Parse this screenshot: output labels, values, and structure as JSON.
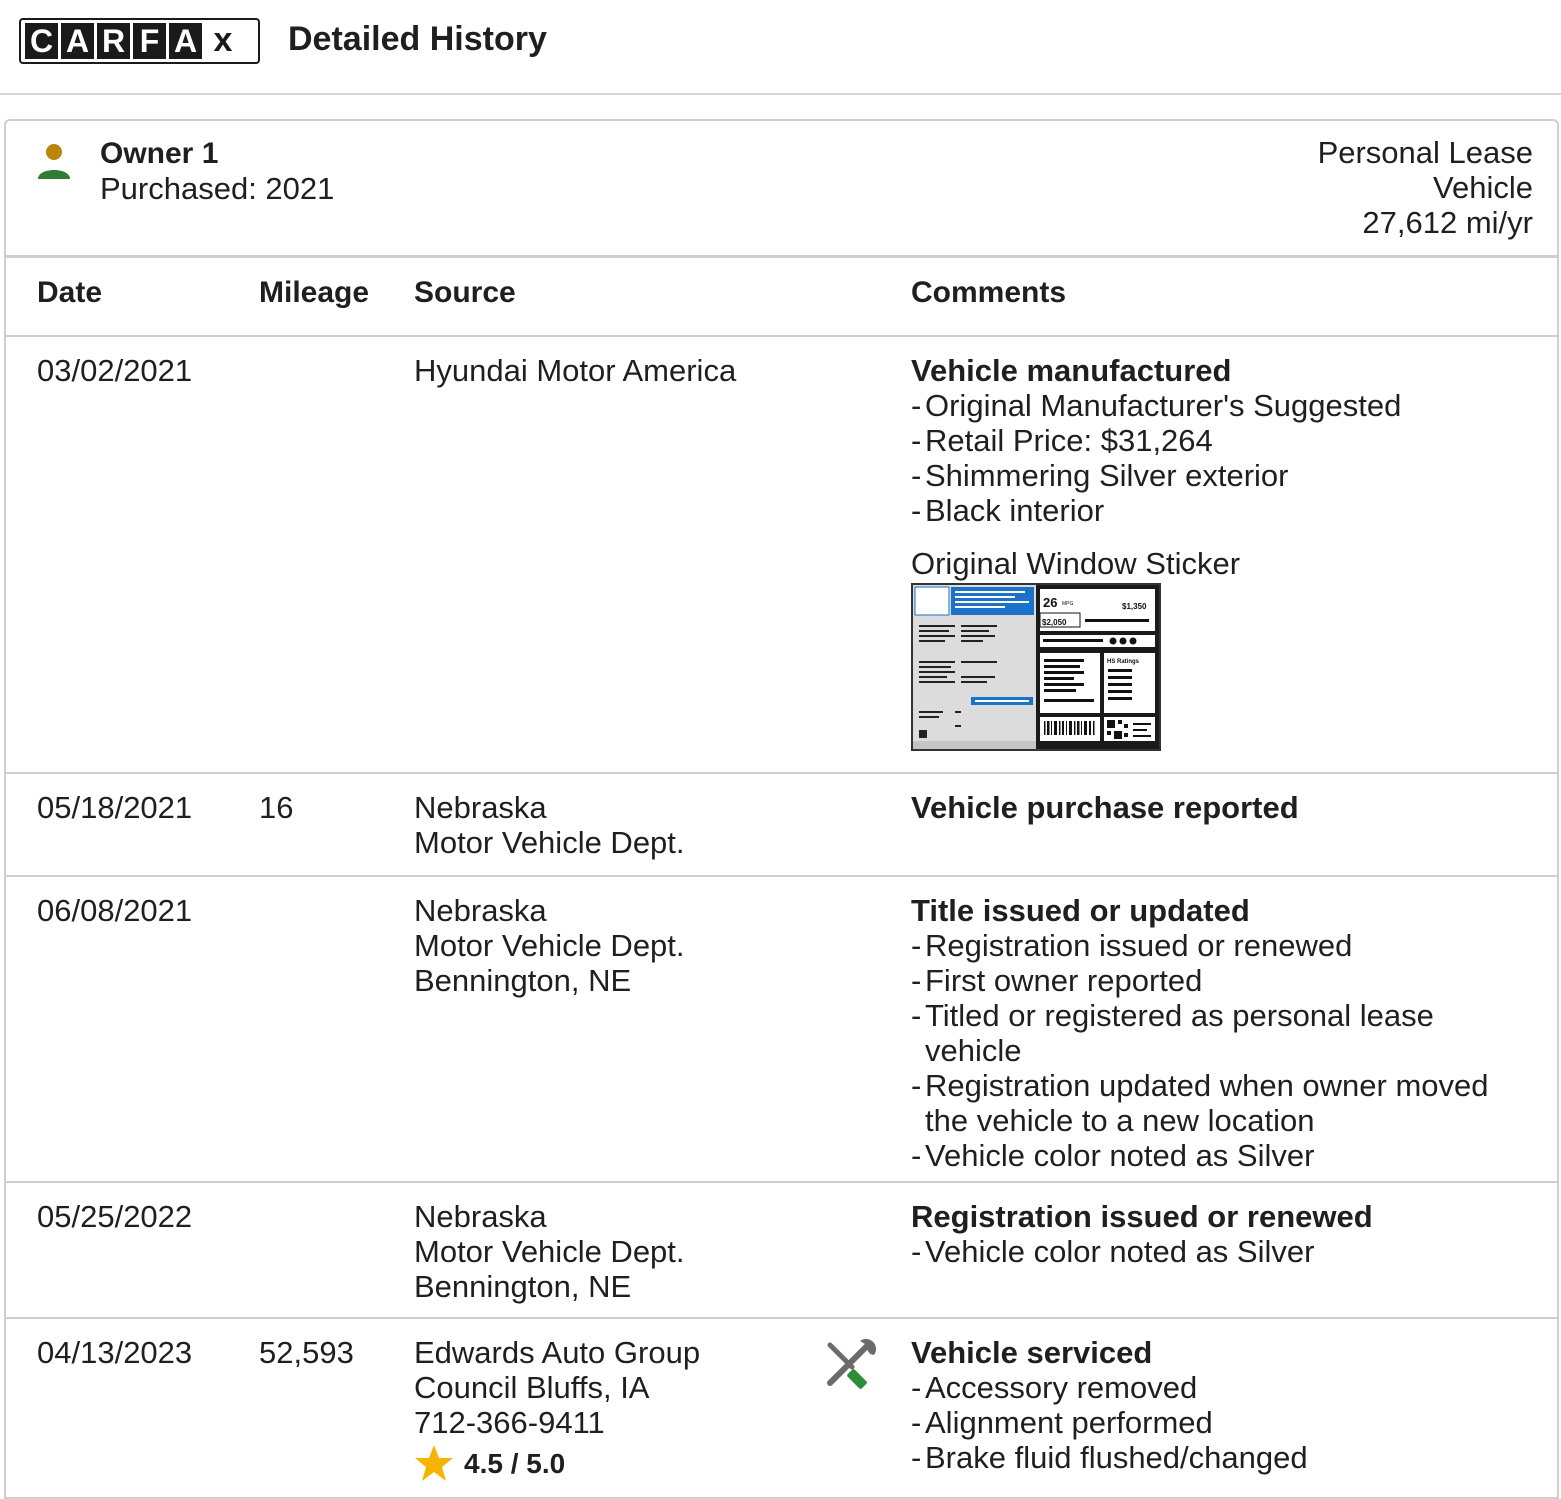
{
  "header": {
    "logo_letters": [
      "C",
      "A",
      "R",
      "F",
      "A",
      "x"
    ],
    "title": "Detailed History"
  },
  "owner": {
    "title": "Owner 1",
    "purchased": "Purchased: 2021",
    "type_line1": "Personal Lease",
    "type_line2": "Vehicle",
    "mileage_rate": "27,612 mi/yr",
    "icon": "person-icon"
  },
  "columns": {
    "date": "Date",
    "mileage": "Mileage",
    "source": "Source",
    "comments": "Comments"
  },
  "rows": [
    {
      "date": "03/02/2021",
      "mileage": "",
      "source": [
        "Hyundai Motor America"
      ],
      "comment_head": "Vehicle manufactured",
      "comment_items": [
        "Original Manufacturer's Suggested",
        "Retail Price: $31,264",
        "Shimmering Silver exterior",
        "Black interior"
      ],
      "sticker_label": "Original Window Sticker",
      "sticker": {
        "mpg": "26",
        "mpg_unit": "MPG",
        "save": "$1,350",
        "cost": "$2,050",
        "ratings_label": "HS Ratings"
      }
    },
    {
      "date": "05/18/2021",
      "mileage": "16",
      "source": [
        "Nebraska",
        "Motor Vehicle Dept."
      ],
      "comment_head": "Vehicle purchase reported",
      "comment_items": []
    },
    {
      "date": "06/08/2021",
      "mileage": "",
      "source": [
        "Nebraska",
        "Motor Vehicle Dept.",
        "Bennington, NE"
      ],
      "comment_head": "Title issued or updated",
      "comment_items": [
        "Registration issued or renewed",
        "First owner reported",
        "Titled or registered as personal lease vehicle",
        "Registration updated when owner moved the vehicle to a new location",
        "Vehicle color noted as Silver"
      ]
    },
    {
      "date": "05/25/2022",
      "mileage": "",
      "source": [
        "Nebraska",
        "Motor Vehicle Dept.",
        "Bennington, NE"
      ],
      "comment_head": "Registration issued or renewed",
      "comment_items": [
        "Vehicle color noted as Silver"
      ]
    },
    {
      "date": "04/13/2023",
      "mileage": "52,593",
      "source": [
        "Edwards Auto Group",
        "Council Bluffs, IA",
        "712-366-9411"
      ],
      "rating": "4.5 / 5.0",
      "rating_icon": "star-icon",
      "service_icon": "wrench-screwdriver-icon",
      "comment_head": "Vehicle serviced",
      "comment_items": [
        "Accessory removed",
        "Alignment performed",
        "Brake fluid flushed/changed"
      ]
    }
  ],
  "colors": {
    "text": "#1f1f1f",
    "divider": "#cfcfcf",
    "owner_head": "#b8860b",
    "owner_body": "#2e7d32",
    "star": "#f4b400",
    "sticker_blue": "#1a73c8",
    "service_green": "#2e8b3a",
    "service_gray": "#6b6b6b"
  }
}
